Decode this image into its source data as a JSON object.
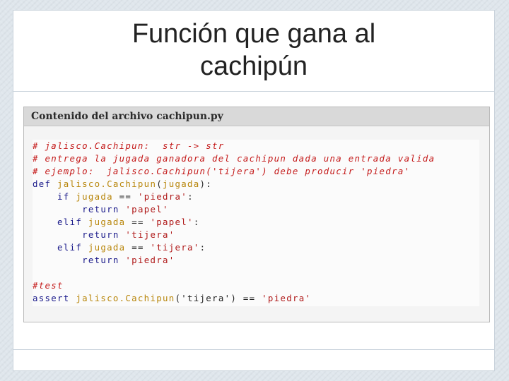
{
  "slide": {
    "title": "Función que gana al\ncachipún"
  },
  "panel": {
    "header": "Contenido del archivo cachipun.py"
  },
  "code": {
    "comment1": "# jalisco.Cachipun:  str -> str",
    "comment2": "# entrega la jugada ganadora del cachipun dada una entrada valida",
    "comment3": "# ejemplo:  jalisco.Cachipun('tijera') debe producir 'piedra'",
    "def_kw": "def",
    "def_fn": "jalisco.Cachipun",
    "def_open": "(",
    "def_arg": "jugada",
    "def_close": "):",
    "if_kw": "if",
    "if_var": "jugada",
    "if_op": "==",
    "if_str": "'piedra'",
    "if_colon": ":",
    "ret1_kw": "return",
    "ret1_str": "'papel'",
    "elif1_kw": "elif",
    "elif1_var": "jugada",
    "elif1_op": "==",
    "elif1_str": "'papel'",
    "elif1_colon": ":",
    "ret2_kw": "return",
    "ret2_str": "'tijera'",
    "elif2_kw": "elif",
    "elif2_var": "jugada",
    "elif2_op": "==",
    "elif2_str": "'tijera'",
    "elif2_colon": ":",
    "ret3_kw": "return",
    "ret3_str": "'piedra'",
    "test_comment": "#test",
    "assert_kw": "assert",
    "assert_fn": "jalisco.Cachipun",
    "assert_arg": "('tijera')",
    "assert_op": "==",
    "assert_str": "'piedra'"
  }
}
